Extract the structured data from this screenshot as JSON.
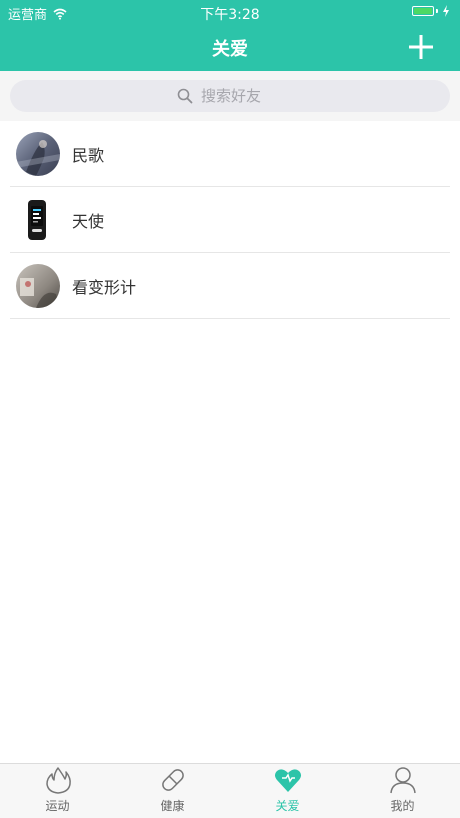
{
  "status_bar": {
    "carrier": "运营商",
    "time": "下午3:28",
    "battery_level": 1.0
  },
  "nav": {
    "title": "关爱",
    "add_icon": "plus-icon"
  },
  "search": {
    "placeholder": "搜索好友",
    "value": ""
  },
  "friends": [
    {
      "name": "民歌",
      "avatar": "photo-avatar"
    },
    {
      "name": "天使",
      "avatar": "smart-band-avatar"
    },
    {
      "name": "看变形计",
      "avatar": "photo-avatar"
    }
  ],
  "tabs": [
    {
      "label": "运动",
      "icon": "flame-icon",
      "active": false
    },
    {
      "label": "健康",
      "icon": "pill-icon",
      "active": false
    },
    {
      "label": "关爱",
      "icon": "heart-icon",
      "active": true
    },
    {
      "label": "我的",
      "icon": "user-icon",
      "active": false
    }
  ],
  "colors": {
    "accent": "#2cc4a9",
    "tab_inactive": "#666666",
    "battery": "#4cd964"
  }
}
